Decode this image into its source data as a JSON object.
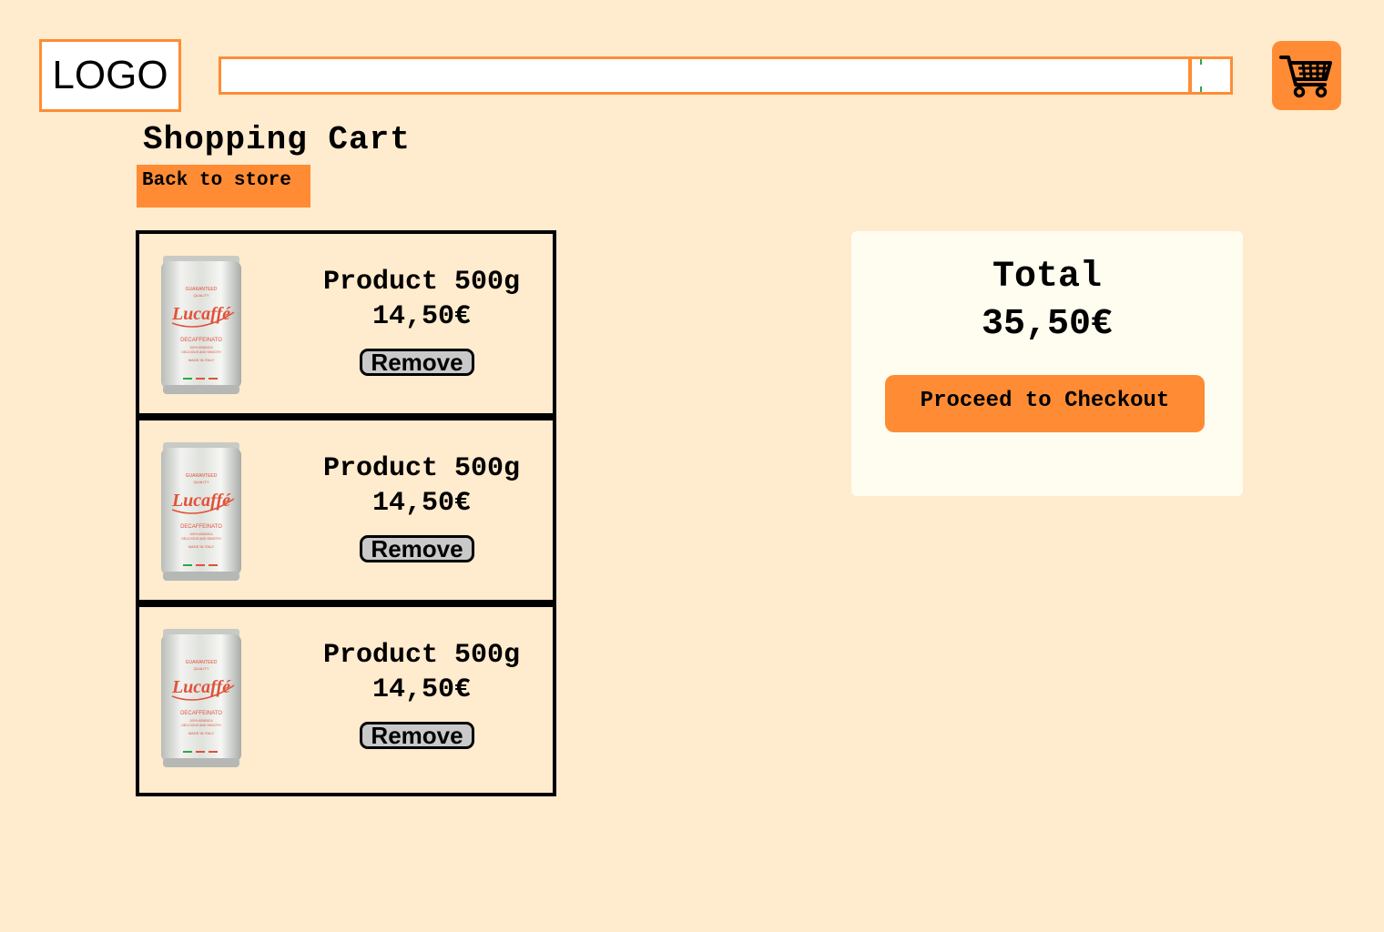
{
  "header": {
    "logo_text": "LOGO",
    "search": {
      "value": "",
      "placeholder": ""
    },
    "cart_icon": "shopping-cart-icon"
  },
  "page": {
    "title": "Shopping Cart",
    "back_label": "Back to store"
  },
  "cart": {
    "items": [
      {
        "name": "Product 500g",
        "price": "14,50€",
        "remove_label": "Remove",
        "image": "coffee-can-image"
      },
      {
        "name": "Product 500g",
        "price": "14,50€",
        "remove_label": "Remove",
        "image": "coffee-can-image"
      },
      {
        "name": "Product 500g",
        "price": "14,50€",
        "remove_label": "Remove",
        "image": "coffee-can-image"
      }
    ]
  },
  "summary": {
    "total_label": "Total",
    "total_value": "35,50€",
    "checkout_label": "Proceed to Checkout"
  },
  "product_image_text": {
    "brand": "Lucaffé",
    "top": "GUARANTEED",
    "quality": "QUALITY",
    "variant": "DECAFFEINATO",
    "line1": "100% ARABICA",
    "line2": "DELICIOUS AND SMOOTH",
    "line3": "MADE IN ITALY"
  },
  "colors": {
    "background": "#ffebcd",
    "accent": "#ff8c34",
    "summary_bg": "#fffdf0",
    "remove_bg": "#c9c9c9"
  }
}
